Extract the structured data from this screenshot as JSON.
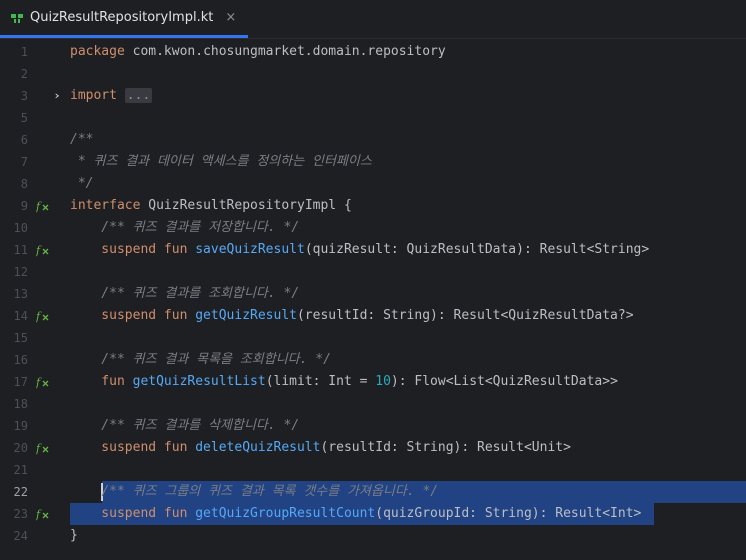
{
  "tab": {
    "title": "QuizResultRepositoryImpl.kt",
    "close": "×"
  },
  "lines": [
    {
      "n": "1",
      "tokens": [
        {
          "t": "package ",
          "c": "kw"
        },
        {
          "t": "com.kwon.chosungmarket.domain.repository",
          "c": "plain"
        }
      ]
    },
    {
      "n": "2",
      "tokens": []
    },
    {
      "n": "3",
      "fold": "›",
      "tokens": [
        {
          "t": "import ",
          "c": "kw"
        },
        {
          "t": "...",
          "c": "folded"
        }
      ]
    },
    {
      "n": "5",
      "tokens": []
    },
    {
      "n": "6",
      "tokens": [
        {
          "t": "/**",
          "c": "cm"
        }
      ]
    },
    {
      "n": "7",
      "tokens": [
        {
          "t": " * 퀴즈 결과 데이터 액세스를 정의하는 인터페이스",
          "c": "cm"
        }
      ]
    },
    {
      "n": "8",
      "tokens": [
        {
          "t": " */",
          "c": "cm"
        }
      ]
    },
    {
      "n": "9",
      "icon": "f",
      "tokens": [
        {
          "t": "interface ",
          "c": "kw"
        },
        {
          "t": "QuizResultRepositoryImpl {",
          "c": "plain"
        }
      ]
    },
    {
      "n": "10",
      "tokens": [
        {
          "t": "    /** 퀴즈 결과를 저장합니다. */",
          "c": "cm"
        }
      ]
    },
    {
      "n": "11",
      "icon": "f",
      "tokens": [
        {
          "t": "    suspend fun ",
          "c": "kw"
        },
        {
          "t": "saveQuizResult",
          "c": "fn"
        },
        {
          "t": "(quizResult: QuizResultData): Result<String>",
          "c": "plain"
        }
      ]
    },
    {
      "n": "12",
      "tokens": []
    },
    {
      "n": "13",
      "tokens": [
        {
          "t": "    /** 퀴즈 결과를 조회합니다. */",
          "c": "cm"
        }
      ]
    },
    {
      "n": "14",
      "icon": "f",
      "tokens": [
        {
          "t": "    suspend fun ",
          "c": "kw"
        },
        {
          "t": "getQuizResult",
          "c": "fn"
        },
        {
          "t": "(resultId: String): Result<QuizResultData?>",
          "c": "plain"
        }
      ]
    },
    {
      "n": "15",
      "tokens": []
    },
    {
      "n": "16",
      "tokens": [
        {
          "t": "    /** 퀴즈 결과 목록을 조회합니다. */",
          "c": "cm"
        }
      ]
    },
    {
      "n": "17",
      "icon": "f",
      "tokens": [
        {
          "t": "    fun ",
          "c": "kw"
        },
        {
          "t": "getQuizResultList",
          "c": "fn"
        },
        {
          "t": "(limit: Int = ",
          "c": "plain"
        },
        {
          "t": "10",
          "c": "num"
        },
        {
          "t": "): Flow<List<QuizResultData>>",
          "c": "plain"
        }
      ]
    },
    {
      "n": "18",
      "tokens": []
    },
    {
      "n": "19",
      "tokens": [
        {
          "t": "    /** 퀴즈 결과를 삭제합니다. */",
          "c": "cm"
        }
      ]
    },
    {
      "n": "20",
      "icon": "f",
      "tokens": [
        {
          "t": "    suspend fun ",
          "c": "kw"
        },
        {
          "t": "deleteQuizResult",
          "c": "fn"
        },
        {
          "t": "(resultId: String): Result<Unit>",
          "c": "plain"
        }
      ]
    },
    {
      "n": "21",
      "tokens": []
    },
    {
      "n": "22",
      "current": true,
      "tokens": [
        {
          "t": "    ",
          "c": "plain"
        },
        {
          "t": "/** 퀴즈 그룹의 퀴즈 결과 목록 갯수를 가져옵니다. */",
          "c": "cm"
        }
      ]
    },
    {
      "n": "23",
      "icon": "f",
      "selected": true,
      "tokens": [
        {
          "t": "    suspend fun ",
          "c": "kw"
        },
        {
          "t": "getQuizGroupResultCount",
          "c": "fn"
        },
        {
          "t": "(quizGroupId: String): Result<Int>",
          "c": "plain"
        }
      ]
    },
    {
      "n": "24",
      "tokens": [
        {
          "t": "}",
          "c": "plain"
        }
      ]
    }
  ]
}
